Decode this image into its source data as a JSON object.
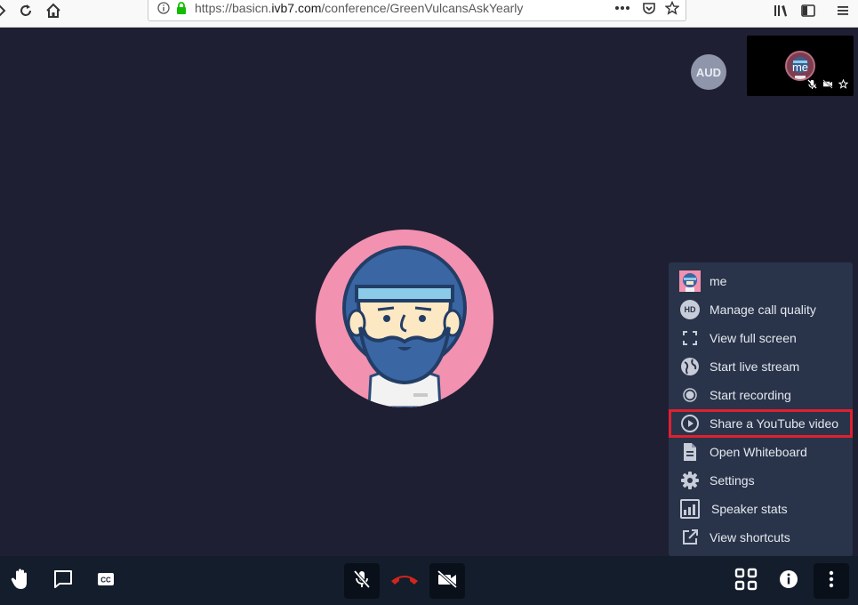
{
  "browser": {
    "url_prefix": "https://basicn.",
    "url_domain": "ivb7.com",
    "url_path": "/conference/GreenVulcansAskYearly"
  },
  "stage": {
    "participant_badge": "AUD",
    "self_view_label": "me"
  },
  "menu": {
    "items": [
      {
        "label": "me",
        "icon": "user-avatar-icon"
      },
      {
        "label": "Manage call quality",
        "icon": "hd-icon"
      },
      {
        "label": "View full screen",
        "icon": "fullscreen-icon"
      },
      {
        "label": "Start live stream",
        "icon": "globe-icon"
      },
      {
        "label": "Start recording",
        "icon": "record-icon"
      },
      {
        "label": "Share a YouTube video",
        "icon": "play-circle-icon",
        "highlighted": true
      },
      {
        "label": "Open Whiteboard",
        "icon": "document-icon"
      },
      {
        "label": "Settings",
        "icon": "gear-icon"
      },
      {
        "label": "Speaker stats",
        "icon": "bar-chart-icon"
      },
      {
        "label": "View shortcuts",
        "icon": "external-link-icon"
      }
    ]
  },
  "colors": {
    "stage_bg": "#1f1f33",
    "menu_bg": "#29344a",
    "highlight": "#e0202e",
    "hangup": "#d0261c",
    "avatar_bg": "#f391b0"
  }
}
